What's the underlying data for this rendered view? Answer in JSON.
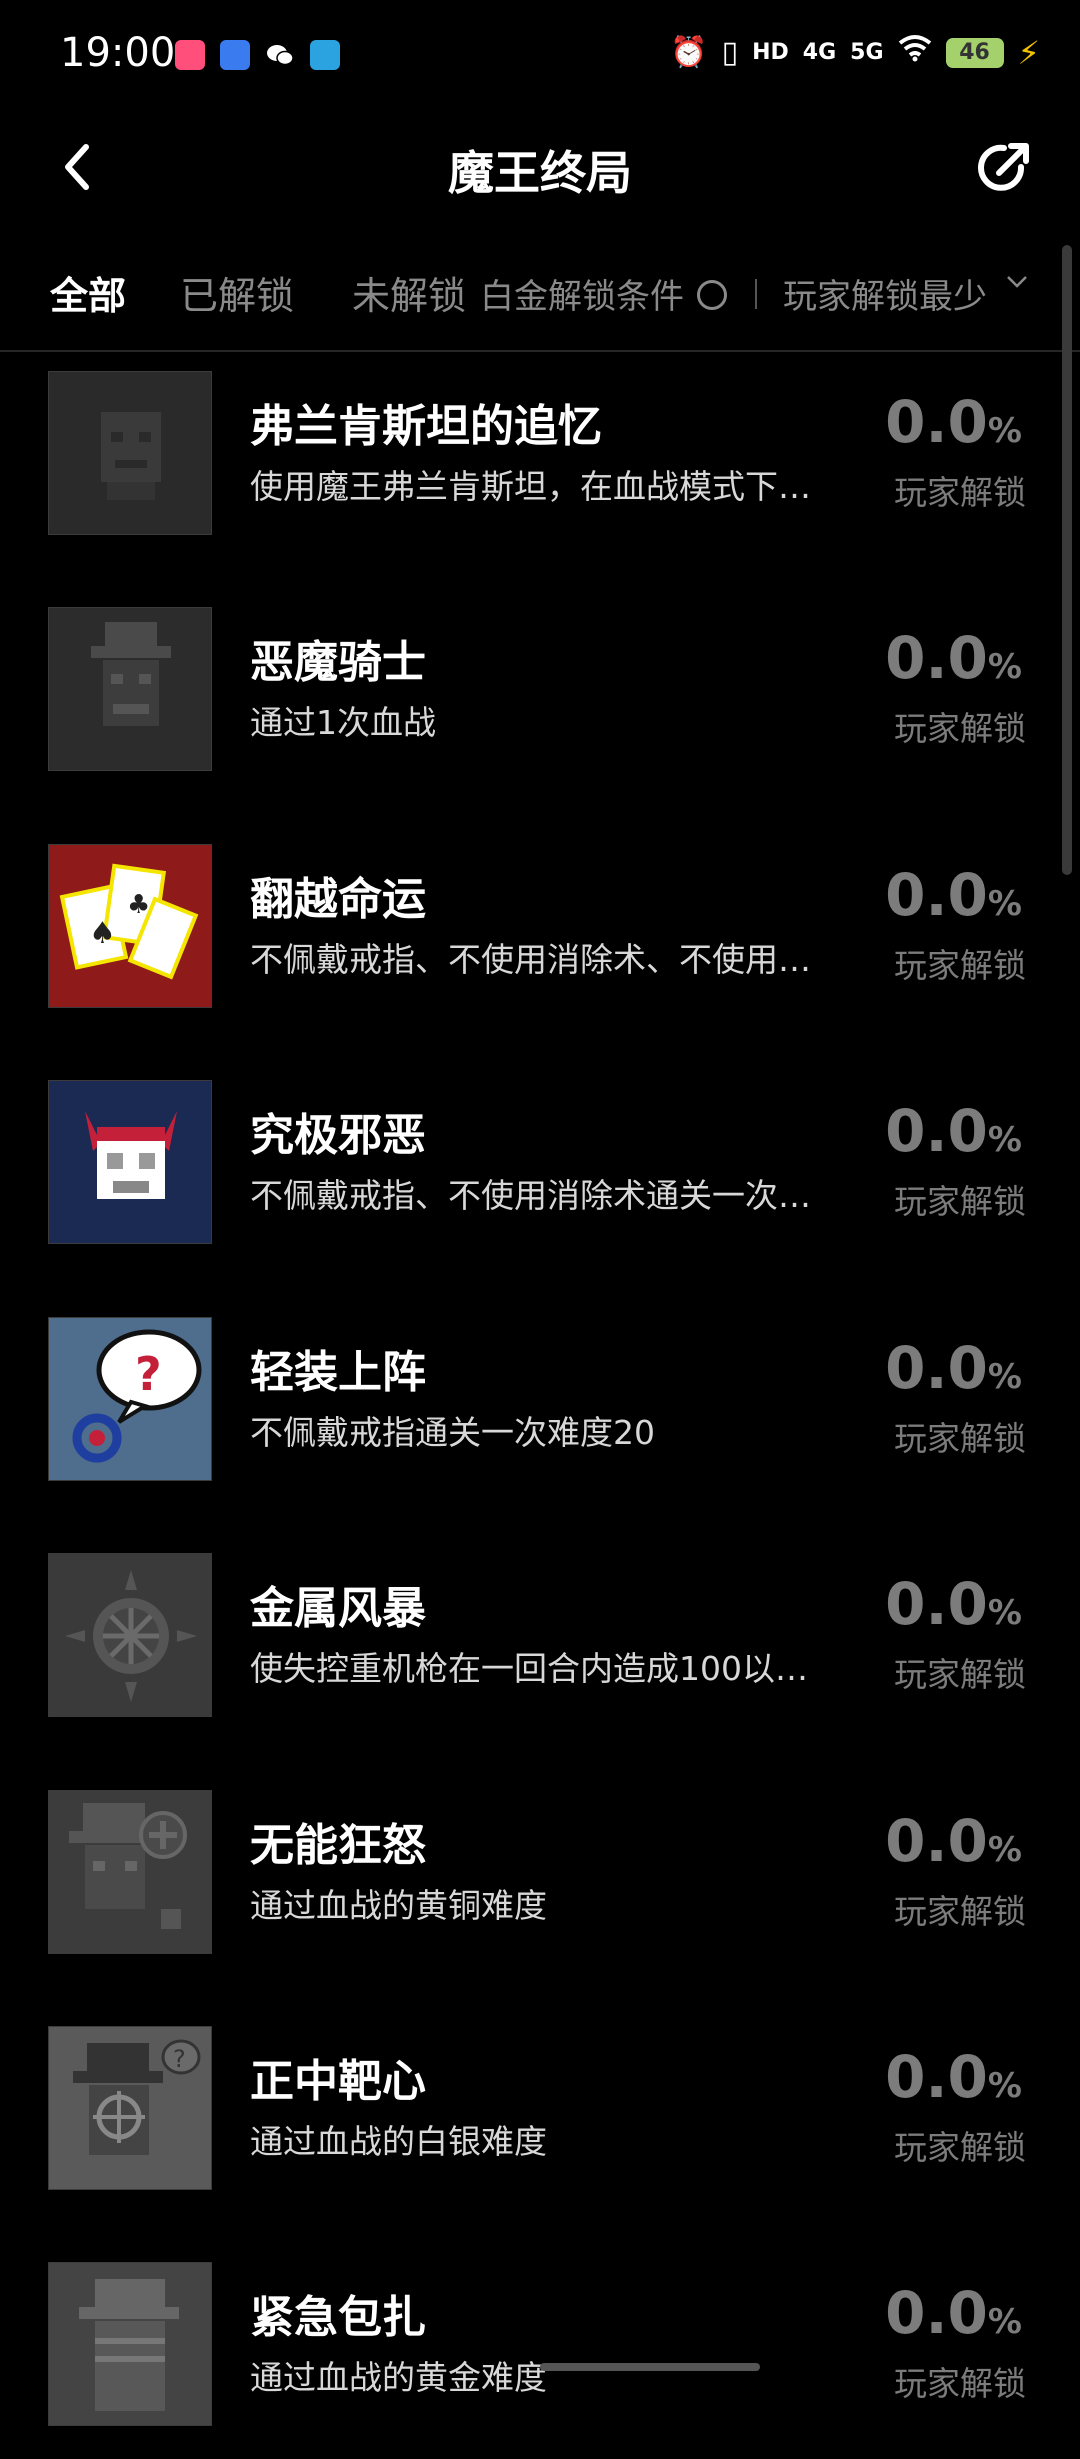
{
  "status_bar": {
    "time": "19:00",
    "network_hd": "HD",
    "network_4g": "4G",
    "network_5g": "5G",
    "battery": "46"
  },
  "header": {
    "title": "魔王终局"
  },
  "tabs": {
    "all": "全部",
    "unlocked": "已解锁",
    "locked": "未解锁",
    "platinum_condition": "白金解锁条件",
    "sort": "玩家解锁最少"
  },
  "achievements": [
    {
      "name": "弗兰肯斯坦的追忆",
      "desc": "使用魔王弗兰肯斯坦，在血战模式下…",
      "percent": "0.0",
      "percent_symbol": "%",
      "percent_label": "玩家解锁"
    },
    {
      "name": "恶魔骑士",
      "desc": "通过1次血战",
      "percent": "0.0",
      "percent_symbol": "%",
      "percent_label": "玩家解锁"
    },
    {
      "name": "翻越命运",
      "desc": "不佩戴戒指、不使用消除术、不使用…",
      "percent": "0.0",
      "percent_symbol": "%",
      "percent_label": "玩家解锁"
    },
    {
      "name": "究极邪恶",
      "desc": "不佩戴戒指、不使用消除术通关一次…",
      "percent": "0.0",
      "percent_symbol": "%",
      "percent_label": "玩家解锁"
    },
    {
      "name": "轻装上阵",
      "desc": "不佩戴戒指通关一次难度20",
      "percent": "0.0",
      "percent_symbol": "%",
      "percent_label": "玩家解锁"
    },
    {
      "name": "金属风暴",
      "desc": "使失控重机枪在一回合内造成100以…",
      "percent": "0.0",
      "percent_symbol": "%",
      "percent_label": "玩家解锁"
    },
    {
      "name": "无能狂怒",
      "desc": "通过血战的黄铜难度",
      "percent": "0.0",
      "percent_symbol": "%",
      "percent_label": "玩家解锁"
    },
    {
      "name": "正中靶心",
      "desc": "通过血战的白银难度",
      "percent": "0.0",
      "percent_symbol": "%",
      "percent_label": "玩家解锁"
    },
    {
      "name": "紧急包扎",
      "desc": "通过血战的黄金难度",
      "percent": "0.0",
      "percent_symbol": "%",
      "percent_label": "玩家解锁"
    }
  ],
  "colors": {
    "background": "#000000",
    "text_primary": "#ffffff",
    "text_muted": "#7c7c7c",
    "battery": "#a4d16b",
    "charging_bolt": "#f2c200"
  }
}
